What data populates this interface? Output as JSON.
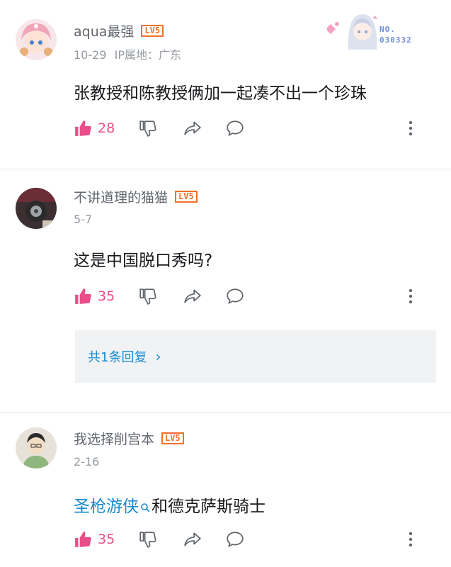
{
  "comments": [
    {
      "username": "aqua最强",
      "level": "LV5",
      "date": "10-29",
      "location": "IP属地：广东",
      "content": "张教授和陈教授俩加一起凑不出一个珍珠",
      "likes": "28",
      "fan_badge": {
        "label": "NO.",
        "number": "030332"
      }
    },
    {
      "username": "不讲道理的猫猫",
      "level": "LV5",
      "date": "5-7",
      "content": "这是中国脱口秀吗?",
      "likes": "35",
      "replies_label": "共1条回复",
      "replies_chevron": "›"
    },
    {
      "username": "我选择削宫本",
      "level": "LV5",
      "date": "2-16",
      "content_keyword": "圣枪游侠",
      "content_rest": "和德克萨斯骑士",
      "likes": "35"
    }
  ],
  "colors": {
    "like": "#ea4d89",
    "level": "#f0722a",
    "link": "#178bcf",
    "meta": "#9499a0"
  },
  "icons": [
    "thumbs-up-icon",
    "thumbs-down-icon",
    "share-icon",
    "comment-icon",
    "more-icon",
    "search-icon"
  ]
}
